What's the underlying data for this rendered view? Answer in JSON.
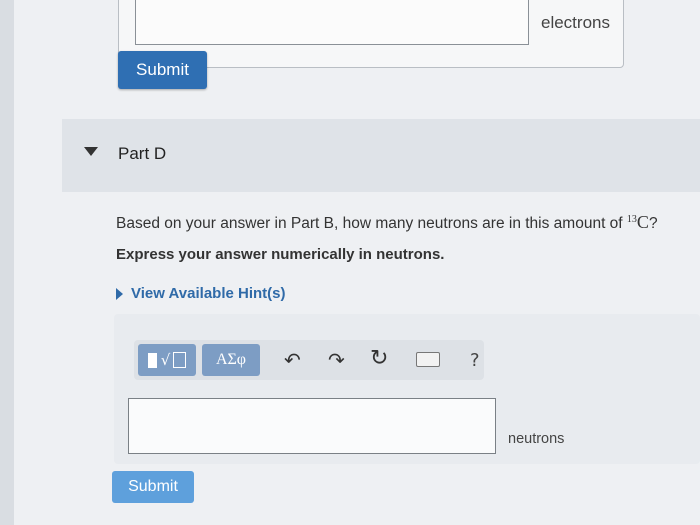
{
  "part_c": {
    "unit_label": "electrons",
    "submit_label": "Submit"
  },
  "part_d": {
    "title": "Part D",
    "question_text": "Based on your answer in Part B, how many neutrons are in this amount of ",
    "isotope_mass_number": "13",
    "isotope_symbol": "C",
    "question_end": "?",
    "instruction": "Express your answer numerically in neutrons.",
    "hint_link": "View Available Hint(s)",
    "toolbar": {
      "templates_icon": "templates-icon",
      "symbols_label": "ΑΣφ",
      "undo_icon": "undo-icon",
      "redo_icon": "redo-icon",
      "reset_icon": "reset-icon",
      "keyboard_icon": "keyboard-icon",
      "help_label": "?"
    },
    "answer_value": "",
    "unit_label": "neutrons",
    "submit_label": "Submit"
  },
  "colors": {
    "submit_active": "#2f6fb3",
    "submit_inactive": "#5ea0dc",
    "link": "#2f6aa8",
    "toolbar_button": "#7d9dc4"
  }
}
